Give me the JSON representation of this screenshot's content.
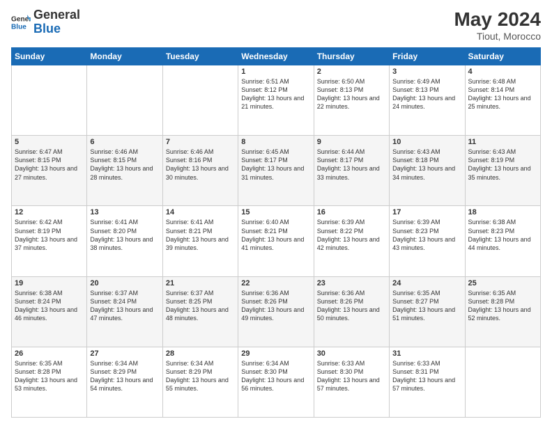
{
  "header": {
    "logo_general": "General",
    "logo_blue": "Blue",
    "month_year": "May 2024",
    "location": "Tiout, Morocco"
  },
  "days_of_week": [
    "Sunday",
    "Monday",
    "Tuesday",
    "Wednesday",
    "Thursday",
    "Friday",
    "Saturday"
  ],
  "weeks": [
    [
      {
        "day": "",
        "info": ""
      },
      {
        "day": "",
        "info": ""
      },
      {
        "day": "",
        "info": ""
      },
      {
        "day": "1",
        "info": "Sunrise: 6:51 AM\nSunset: 8:12 PM\nDaylight: 13 hours\nand 21 minutes."
      },
      {
        "day": "2",
        "info": "Sunrise: 6:50 AM\nSunset: 8:13 PM\nDaylight: 13 hours\nand 22 minutes."
      },
      {
        "day": "3",
        "info": "Sunrise: 6:49 AM\nSunset: 8:13 PM\nDaylight: 13 hours\nand 24 minutes."
      },
      {
        "day": "4",
        "info": "Sunrise: 6:48 AM\nSunset: 8:14 PM\nDaylight: 13 hours\nand 25 minutes."
      }
    ],
    [
      {
        "day": "5",
        "info": "Sunrise: 6:47 AM\nSunset: 8:15 PM\nDaylight: 13 hours\nand 27 minutes."
      },
      {
        "day": "6",
        "info": "Sunrise: 6:46 AM\nSunset: 8:15 PM\nDaylight: 13 hours\nand 28 minutes."
      },
      {
        "day": "7",
        "info": "Sunrise: 6:46 AM\nSunset: 8:16 PM\nDaylight: 13 hours\nand 30 minutes."
      },
      {
        "day": "8",
        "info": "Sunrise: 6:45 AM\nSunset: 8:17 PM\nDaylight: 13 hours\nand 31 minutes."
      },
      {
        "day": "9",
        "info": "Sunrise: 6:44 AM\nSunset: 8:17 PM\nDaylight: 13 hours\nand 33 minutes."
      },
      {
        "day": "10",
        "info": "Sunrise: 6:43 AM\nSunset: 8:18 PM\nDaylight: 13 hours\nand 34 minutes."
      },
      {
        "day": "11",
        "info": "Sunrise: 6:43 AM\nSunset: 8:19 PM\nDaylight: 13 hours\nand 35 minutes."
      }
    ],
    [
      {
        "day": "12",
        "info": "Sunrise: 6:42 AM\nSunset: 8:19 PM\nDaylight: 13 hours\nand 37 minutes."
      },
      {
        "day": "13",
        "info": "Sunrise: 6:41 AM\nSunset: 8:20 PM\nDaylight: 13 hours\nand 38 minutes."
      },
      {
        "day": "14",
        "info": "Sunrise: 6:41 AM\nSunset: 8:21 PM\nDaylight: 13 hours\nand 39 minutes."
      },
      {
        "day": "15",
        "info": "Sunrise: 6:40 AM\nSunset: 8:21 PM\nDaylight: 13 hours\nand 41 minutes."
      },
      {
        "day": "16",
        "info": "Sunrise: 6:39 AM\nSunset: 8:22 PM\nDaylight: 13 hours\nand 42 minutes."
      },
      {
        "day": "17",
        "info": "Sunrise: 6:39 AM\nSunset: 8:23 PM\nDaylight: 13 hours\nand 43 minutes."
      },
      {
        "day": "18",
        "info": "Sunrise: 6:38 AM\nSunset: 8:23 PM\nDaylight: 13 hours\nand 44 minutes."
      }
    ],
    [
      {
        "day": "19",
        "info": "Sunrise: 6:38 AM\nSunset: 8:24 PM\nDaylight: 13 hours\nand 46 minutes."
      },
      {
        "day": "20",
        "info": "Sunrise: 6:37 AM\nSunset: 8:24 PM\nDaylight: 13 hours\nand 47 minutes."
      },
      {
        "day": "21",
        "info": "Sunrise: 6:37 AM\nSunset: 8:25 PM\nDaylight: 13 hours\nand 48 minutes."
      },
      {
        "day": "22",
        "info": "Sunrise: 6:36 AM\nSunset: 8:26 PM\nDaylight: 13 hours\nand 49 minutes."
      },
      {
        "day": "23",
        "info": "Sunrise: 6:36 AM\nSunset: 8:26 PM\nDaylight: 13 hours\nand 50 minutes."
      },
      {
        "day": "24",
        "info": "Sunrise: 6:35 AM\nSunset: 8:27 PM\nDaylight: 13 hours\nand 51 minutes."
      },
      {
        "day": "25",
        "info": "Sunrise: 6:35 AM\nSunset: 8:28 PM\nDaylight: 13 hours\nand 52 minutes."
      }
    ],
    [
      {
        "day": "26",
        "info": "Sunrise: 6:35 AM\nSunset: 8:28 PM\nDaylight: 13 hours\nand 53 minutes."
      },
      {
        "day": "27",
        "info": "Sunrise: 6:34 AM\nSunset: 8:29 PM\nDaylight: 13 hours\nand 54 minutes."
      },
      {
        "day": "28",
        "info": "Sunrise: 6:34 AM\nSunset: 8:29 PM\nDaylight: 13 hours\nand 55 minutes."
      },
      {
        "day": "29",
        "info": "Sunrise: 6:34 AM\nSunset: 8:30 PM\nDaylight: 13 hours\nand 56 minutes."
      },
      {
        "day": "30",
        "info": "Sunrise: 6:33 AM\nSunset: 8:30 PM\nDaylight: 13 hours\nand 57 minutes."
      },
      {
        "day": "31",
        "info": "Sunrise: 6:33 AM\nSunset: 8:31 PM\nDaylight: 13 hours\nand 57 minutes."
      },
      {
        "day": "",
        "info": ""
      }
    ]
  ]
}
